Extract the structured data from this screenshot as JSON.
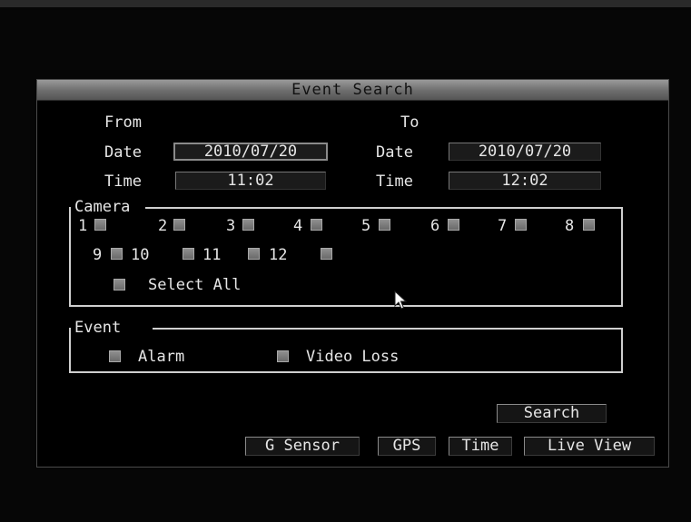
{
  "dialog": {
    "title": "Event Search"
  },
  "range": {
    "from_label": "From",
    "to_label": "To",
    "from_date_label": "Date",
    "from_date_value": "2010/07/20",
    "from_time_label": "Time",
    "from_time_value": "11:02",
    "to_date_label": "Date",
    "to_date_value": "2010/07/20",
    "to_time_label": "Time",
    "to_time_value": "12:02"
  },
  "camera": {
    "legend": "Camera",
    "numbers": [
      "1",
      "2",
      "3",
      "4",
      "5",
      "6",
      "7",
      "8",
      "9",
      "10",
      "11",
      "12"
    ],
    "select_all_label": "Select All"
  },
  "event": {
    "legend": "Event",
    "alarm_label": "Alarm",
    "video_loss_label": "Video Loss"
  },
  "buttons": {
    "search": "Search",
    "g_sensor": "G Sensor",
    "gps": "GPS",
    "time": "Time",
    "live_view": "Live View"
  },
  "icons": {
    "cursor": "mouse-pointer-icon",
    "checkbox": "checkbox-icon"
  },
  "colors": {
    "title_bar": "#7d7d7d",
    "background": "#000000",
    "text": "#e6e6e6"
  }
}
